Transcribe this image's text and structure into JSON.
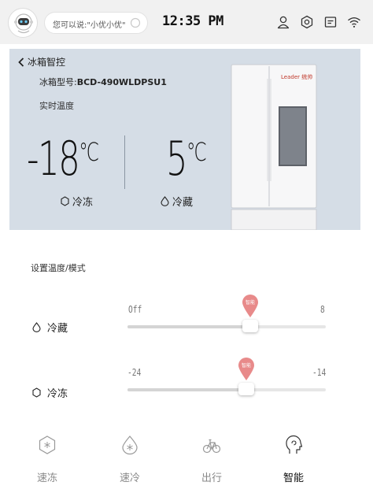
{
  "header": {
    "search_placeholder": "您可以说:\"小优小优\"",
    "time": "12:35 PM",
    "icons": [
      "robot-avatar-icon",
      "search-icon",
      "user-icon",
      "settings-icon",
      "message-icon",
      "wifi-icon"
    ]
  },
  "fridge": {
    "back_label": "冰箱智控",
    "model_prefix": "冰箱型号:",
    "model": "BCD-490WLDPSU1",
    "realtime_label": "实时温度",
    "freezer": {
      "value": "-18",
      "unit": "℃",
      "label": "冷冻"
    },
    "refrigerator": {
      "value": "5",
      "unit": "℃",
      "label": "冷藏"
    },
    "brand": "Leader 统帅"
  },
  "settings": {
    "title": "设置温度/模式",
    "refrigerator": {
      "label": "冷藏",
      "min_label": "Off",
      "max_label": "8",
      "pin_label": "智能",
      "level": 0.62
    },
    "freezer": {
      "label": "冷冻",
      "min_label": "-24",
      "max_label": "-14",
      "pin_label": "智能",
      "level": 0.6
    },
    "accent_color": "#e88a8a"
  },
  "modes": [
    {
      "label": "速冻",
      "icon": "hexagon-snowflake-icon",
      "active": false
    },
    {
      "label": "速冷",
      "icon": "drop-snowflake-icon",
      "active": false
    },
    {
      "label": "出行",
      "icon": "bicycle-icon",
      "active": false
    },
    {
      "label": "智能",
      "icon": "smart-head-icon",
      "active": true
    }
  ]
}
